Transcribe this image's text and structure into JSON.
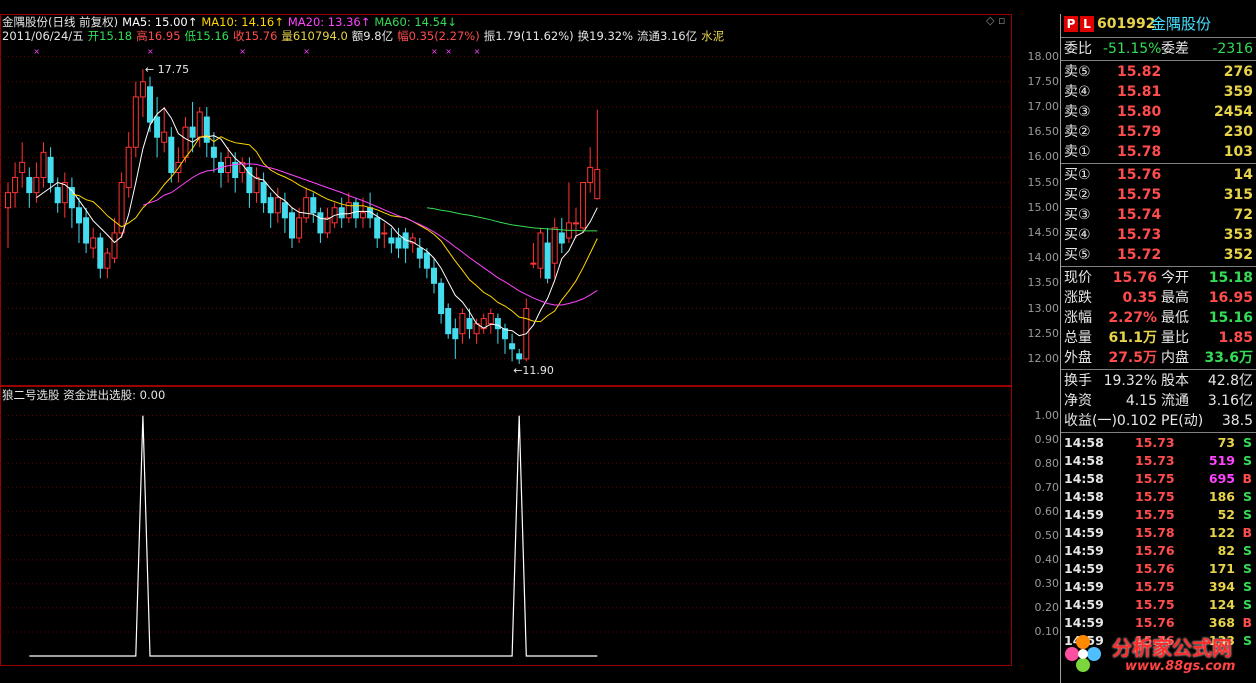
{
  "header": {
    "line1": [
      {
        "text": "金隅股份(日线 前复权)",
        "color": "#e6e6e6"
      },
      {
        "text": "MA5: 15.00↑",
        "color": "#ffffff"
      },
      {
        "text": "MA10: 14.16↑",
        "color": "#ffd700"
      },
      {
        "text": "MA20: 13.36↑",
        "color": "#ff44ff"
      },
      {
        "text": "MA60: 14.54↓",
        "color": "#33dd55"
      }
    ],
    "line2": [
      {
        "text": "2011/06/24/五",
        "color": "#e6e6e6"
      },
      {
        "text": "开15.18",
        "color": "#33dd55"
      },
      {
        "text": "高16.95",
        "color": "#ff4d4d"
      },
      {
        "text": "低15.16",
        "color": "#33dd55"
      },
      {
        "text": "收15.76",
        "color": "#ff4d4d"
      },
      {
        "text": "量610794.0",
        "color": "#e8d44a"
      },
      {
        "text": "额9.8亿",
        "color": "#e6e6e6"
      },
      {
        "text": "幅0.35(2.27%)",
        "color": "#ff4d4d"
      },
      {
        "text": "振1.79(11.62%)",
        "color": "#e6e6e6"
      },
      {
        "text": "换19.32%",
        "color": "#e6e6e6"
      },
      {
        "text": "流通3.16亿",
        "color": "#e6e6e6"
      },
      {
        "text": "水泥",
        "color": "#e8d44a"
      }
    ]
  },
  "indicator_header": "狼二号选股  资金进出选股: 0.00",
  "annotations": {
    "high": "17.75",
    "low": "←11.90"
  },
  "chart_data": [
    {
      "type": "candlestick",
      "yrange": [
        11.7,
        18.25
      ],
      "yticks": [
        "18.00",
        "17.50",
        "17.00",
        "16.50",
        "16.00",
        "15.50",
        "15.00",
        "14.50",
        "14.00",
        "13.50",
        "13.00",
        "12.50",
        "12.00"
      ],
      "candles": [
        [
          15.0,
          15.3,
          14.2,
          15.5
        ],
        [
          15.3,
          15.6,
          15.0,
          15.9
        ],
        [
          15.7,
          15.9,
          15.4,
          16.3
        ],
        [
          15.6,
          15.3,
          15.0,
          15.8
        ],
        [
          15.3,
          15.6,
          15.1,
          15.9
        ],
        [
          15.6,
          16.1,
          15.4,
          16.3
        ],
        [
          16.0,
          15.5,
          15.3,
          16.2
        ],
        [
          15.4,
          15.1,
          14.9,
          15.6
        ],
        [
          15.1,
          15.5,
          14.8,
          15.7
        ],
        [
          15.4,
          15.0,
          14.6,
          15.6
        ],
        [
          15.0,
          14.7,
          14.3,
          15.2
        ],
        [
          14.8,
          14.3,
          14.1,
          15.0
        ],
        [
          14.2,
          14.4,
          14.0,
          14.6
        ],
        [
          14.4,
          13.8,
          13.6,
          14.5
        ],
        [
          13.8,
          14.1,
          13.6,
          14.2
        ],
        [
          14.0,
          14.5,
          13.9,
          14.8
        ],
        [
          14.5,
          15.5,
          14.4,
          15.7
        ],
        [
          15.4,
          16.2,
          15.2,
          16.5
        ],
        [
          16.2,
          17.2,
          16.0,
          17.5
        ],
        [
          17.2,
          17.5,
          16.8,
          17.75
        ],
        [
          17.4,
          16.7,
          16.5,
          17.6
        ],
        [
          16.8,
          16.4,
          16.0,
          17.2
        ],
        [
          16.3,
          16.5,
          16.1,
          17.0
        ],
        [
          16.4,
          15.7,
          15.5,
          16.6
        ],
        [
          15.7,
          15.9,
          15.5,
          16.2
        ],
        [
          16.0,
          16.6,
          15.9,
          16.8
        ],
        [
          16.6,
          16.4,
          16.1,
          17.1
        ],
        [
          16.4,
          16.9,
          16.2,
          17.0
        ],
        [
          16.8,
          16.3,
          16.0,
          17.0
        ],
        [
          16.2,
          16.0,
          15.7,
          16.5
        ],
        [
          15.9,
          15.7,
          15.4,
          16.1
        ],
        [
          15.7,
          16.0,
          15.5,
          16.2
        ],
        [
          15.9,
          15.6,
          15.3,
          16.1
        ],
        [
          15.7,
          15.9,
          15.5,
          16.0
        ],
        [
          15.8,
          15.3,
          15.0,
          16.0
        ],
        [
          15.3,
          15.6,
          15.1,
          15.8
        ],
        [
          15.5,
          15.1,
          14.9,
          15.7
        ],
        [
          15.2,
          14.9,
          14.6,
          15.3
        ],
        [
          14.9,
          15.2,
          14.7,
          15.4
        ],
        [
          15.1,
          14.8,
          14.5,
          15.3
        ],
        [
          14.9,
          14.4,
          14.2,
          15.0
        ],
        [
          14.4,
          14.8,
          14.3,
          15.0
        ],
        [
          14.8,
          15.2,
          14.7,
          15.4
        ],
        [
          15.2,
          14.9,
          14.7,
          15.3
        ],
        [
          14.9,
          14.5,
          14.3,
          15.0
        ],
        [
          14.5,
          14.8,
          14.4,
          15.0
        ],
        [
          14.7,
          15.0,
          14.6,
          15.1
        ],
        [
          15.0,
          14.8,
          14.6,
          15.2
        ],
        [
          14.8,
          15.1,
          14.7,
          15.3
        ],
        [
          15.1,
          14.8,
          14.6,
          15.2
        ],
        [
          14.8,
          14.9,
          14.6,
          15.2
        ],
        [
          15.0,
          14.8,
          14.6,
          15.3
        ],
        [
          14.8,
          14.4,
          14.2,
          14.9
        ],
        [
          14.5,
          14.5,
          14.2,
          14.7
        ],
        [
          14.4,
          14.3,
          14.1,
          14.6
        ],
        [
          14.4,
          14.2,
          14.0,
          14.6
        ],
        [
          14.5,
          14.2,
          13.9,
          14.6
        ],
        [
          14.3,
          14.4,
          14.1,
          14.5
        ],
        [
          14.2,
          14.0,
          13.8,
          14.4
        ],
        [
          14.1,
          13.8,
          13.6,
          14.2
        ],
        [
          13.8,
          13.5,
          13.3,
          14.0
        ],
        [
          13.5,
          12.9,
          12.7,
          13.6
        ],
        [
          13.0,
          12.5,
          12.4,
          13.1
        ],
        [
          12.6,
          12.4,
          12.0,
          12.8
        ],
        [
          12.5,
          12.9,
          12.3,
          13.0
        ],
        [
          12.8,
          12.6,
          12.4,
          13.0
        ],
        [
          12.5,
          12.7,
          12.3,
          12.8
        ],
        [
          12.6,
          12.8,
          12.5,
          12.9
        ],
        [
          12.7,
          12.9,
          12.5,
          13.0
        ],
        [
          12.8,
          12.6,
          12.3,
          12.9
        ],
        [
          12.6,
          12.4,
          12.1,
          12.7
        ],
        [
          12.3,
          12.2,
          11.95,
          12.5
        ],
        [
          12.1,
          12.0,
          11.9,
          12.2
        ],
        [
          12.0,
          13.0,
          11.95,
          13.2
        ],
        [
          13.9,
          13.9,
          13.8,
          14.3
        ],
        [
          13.8,
          14.5,
          13.6,
          14.6
        ],
        [
          14.3,
          13.6,
          13.5,
          14.6
        ],
        [
          13.9,
          14.6,
          13.6,
          14.8
        ],
        [
          14.5,
          14.3,
          14.1,
          14.8
        ],
        [
          14.4,
          14.7,
          14.3,
          15.5
        ],
        [
          14.7,
          14.7,
          14.4,
          15.0
        ],
        [
          14.6,
          15.5,
          14.5,
          15.5
        ],
        [
          15.5,
          15.8,
          15.3,
          16.2
        ],
        [
          15.18,
          15.76,
          15.16,
          16.95
        ]
      ],
      "ma_series": [
        {
          "name": "MA5",
          "color": "#ffffff",
          "values": [
            null,
            null,
            null,
            null,
            15.2,
            15.3,
            15.4,
            15.5,
            15.46,
            15.34,
            15.15,
            14.95,
            14.74,
            14.6,
            14.46,
            14.31,
            14.43,
            14.87,
            15.5,
            16.17,
            16.64,
            16.86,
            16.98,
            16.78,
            16.47,
            16.37,
            16.3,
            16.4,
            16.41,
            16.43,
            16.36,
            16.16,
            15.98,
            15.86,
            15.68,
            15.58,
            15.55,
            15.38,
            15.23,
            15.14,
            15.0,
            14.91,
            14.89,
            14.87,
            14.79,
            14.77,
            14.85,
            14.88,
            14.88,
            14.92,
            14.93,
            14.92,
            14.83,
            14.74,
            14.64,
            14.47,
            14.36,
            14.32,
            14.23,
            14.14,
            14.0,
            13.8,
            13.53,
            13.26,
            13.13,
            12.93,
            12.7,
            12.61,
            12.69,
            12.67,
            12.58,
            12.56,
            12.46,
            12.5,
            12.67,
            12.96,
            13.2,
            13.56,
            13.99,
            14.15,
            14.44,
            14.51,
            14.72,
            15.0
          ]
        },
        {
          "name": "MA10",
          "color": "#ffd700",
          "values": [
            null,
            null,
            null,
            null,
            null,
            null,
            null,
            null,
            null,
            15.27,
            15.24,
            15.16,
            15.12,
            14.99,
            14.84,
            14.73,
            14.62,
            14.7,
            14.8,
            15.0,
            15.13,
            15.27,
            15.46,
            15.61,
            15.79,
            16.0,
            16.18,
            16.4,
            16.43,
            16.31,
            16.41,
            16.34,
            16.29,
            16.27,
            16.25,
            16.11,
            15.88,
            15.75,
            15.67,
            15.61,
            15.54,
            15.45,
            15.38,
            15.32,
            15.24,
            15.17,
            15.12,
            15.07,
            15.04,
            15.04,
            15.04,
            15.0,
            14.96,
            14.9,
            14.84,
            14.82,
            14.8,
            14.73,
            14.65,
            14.57,
            14.47,
            14.34,
            14.14,
            13.94,
            13.76,
            13.57,
            13.45,
            13.32,
            13.24,
            13.12,
            13.05,
            12.95,
            12.83,
            12.8,
            12.75,
            12.74,
            12.86,
            12.95,
            13.17,
            13.35,
            13.55,
            13.81,
            14.1,
            14.39
          ]
        },
        {
          "name": "MA20",
          "color": "#ff44ff",
          "values": [
            null,
            null,
            null,
            null,
            null,
            null,
            null,
            null,
            null,
            null,
            null,
            null,
            null,
            null,
            null,
            null,
            null,
            null,
            null,
            15.05,
            15.1,
            15.15,
            15.25,
            15.3,
            15.4,
            15.5,
            15.6,
            15.68,
            15.73,
            15.75,
            15.8,
            15.83,
            15.86,
            15.87,
            15.87,
            15.86,
            15.82,
            15.79,
            15.75,
            15.7,
            15.65,
            15.6,
            15.55,
            15.5,
            15.45,
            15.4,
            15.35,
            15.3,
            15.24,
            15.19,
            15.14,
            15.08,
            15.02,
            14.96,
            14.9,
            14.84,
            14.79,
            14.73,
            14.67,
            14.6,
            14.52,
            14.43,
            14.33,
            14.22,
            14.12,
            14.01,
            13.91,
            13.81,
            13.71,
            13.61,
            13.53,
            13.44,
            13.35,
            13.28,
            13.21,
            13.15,
            13.1,
            13.07,
            13.07,
            13.1,
            13.14,
            13.19,
            13.27,
            13.36
          ]
        },
        {
          "name": "MA60",
          "color": "#33dd55",
          "values": [
            null,
            null,
            null,
            null,
            null,
            null,
            null,
            null,
            null,
            null,
            null,
            null,
            null,
            null,
            null,
            null,
            null,
            null,
            null,
            null,
            null,
            null,
            null,
            null,
            null,
            null,
            null,
            null,
            null,
            null,
            null,
            null,
            null,
            null,
            null,
            null,
            null,
            null,
            null,
            null,
            null,
            null,
            null,
            null,
            null,
            null,
            null,
            null,
            null,
            null,
            null,
            null,
            null,
            null,
            null,
            null,
            null,
            null,
            null,
            15.0,
            14.98,
            14.95,
            14.93,
            14.9,
            14.87,
            14.85,
            14.82,
            14.79,
            14.76,
            14.72,
            14.69,
            14.66,
            14.64,
            14.62,
            14.6,
            14.59,
            14.58,
            14.57,
            14.56,
            14.55,
            14.55,
            14.54,
            14.54,
            14.54
          ]
        }
      ]
    },
    {
      "type": "line",
      "yrange": [
        0.0,
        1.04
      ],
      "yticks": [
        "1.00",
        "0.90",
        "0.80",
        "0.70",
        "0.60",
        "0.50",
        "0.40",
        "0.30",
        "0.20",
        "0.10"
      ],
      "peaks_at": [
        19,
        72
      ],
      "values_note": ""
    }
  ],
  "panel": {
    "badges": [
      "P",
      "L"
    ],
    "code": "601992",
    "name": "金隅股份",
    "weibi": {
      "label": "委比",
      "value": "-51.15%",
      "label2": "委差",
      "value2": "-2316"
    },
    "sells": [
      {
        "label": "卖⑤",
        "price": "15.82",
        "vol": "276"
      },
      {
        "label": "卖④",
        "price": "15.81",
        "vol": "359"
      },
      {
        "label": "卖③",
        "price": "15.80",
        "vol": "2454"
      },
      {
        "label": "卖②",
        "price": "15.79",
        "vol": "230"
      },
      {
        "label": "卖①",
        "price": "15.78",
        "vol": "103"
      }
    ],
    "buys": [
      {
        "label": "买①",
        "price": "15.76",
        "vol": "14"
      },
      {
        "label": "买②",
        "price": "15.75",
        "vol": "315"
      },
      {
        "label": "买③",
        "price": "15.74",
        "vol": "72"
      },
      {
        "label": "买④",
        "price": "15.73",
        "vol": "353"
      },
      {
        "label": "买⑤",
        "price": "15.72",
        "vol": "352"
      }
    ],
    "stats": [
      {
        "l1": "现价",
        "v1": "15.76",
        "c1": "red",
        "l2": "今开",
        "v2": "15.18",
        "c2": "green"
      },
      {
        "l1": "涨跌",
        "v1": "0.35",
        "c1": "red",
        "l2": "最高",
        "v2": "16.95",
        "c2": "red"
      },
      {
        "l1": "涨幅",
        "v1": "2.27%",
        "c1": "red",
        "l2": "最低",
        "v2": "15.16",
        "c2": "green"
      },
      {
        "l1": "总量",
        "v1": "61.1万",
        "c1": "yellow",
        "l2": "量比",
        "v2": "1.85",
        "c2": "red"
      },
      {
        "l1": "外盘",
        "v1": "27.5万",
        "c1": "red",
        "l2": "内盘",
        "v2": "33.6万",
        "c2": "green"
      }
    ],
    "stats2": [
      {
        "l1": "换手",
        "v1": "19.32%",
        "l2": "股本",
        "v2": "42.8亿"
      },
      {
        "l1": "净资",
        "v1": "4.15",
        "l2": "流通",
        "v2": "3.16亿"
      },
      {
        "l1": "收益(一)",
        "v1": "0.102",
        "l2": "PE(动)",
        "v2": "38.5"
      }
    ],
    "ticks": [
      {
        "time": "14:58",
        "price": "15.73",
        "vol": "73",
        "vcolor": "yellow",
        "side": "S"
      },
      {
        "time": "14:58",
        "price": "15.73",
        "vol": "519",
        "vcolor": "magenta",
        "side": "S"
      },
      {
        "time": "14:58",
        "price": "15.75",
        "vol": "695",
        "vcolor": "magenta",
        "side": "B"
      },
      {
        "time": "14:58",
        "price": "15.75",
        "vol": "186",
        "vcolor": "yellow",
        "side": "S"
      },
      {
        "time": "14:59",
        "price": "15.75",
        "vol": "52",
        "vcolor": "yellow",
        "side": "S"
      },
      {
        "time": "14:59",
        "price": "15.78",
        "vol": "122",
        "vcolor": "yellow",
        "side": "B"
      },
      {
        "time": "14:59",
        "price": "15.76",
        "vol": "82",
        "vcolor": "yellow",
        "side": "S"
      },
      {
        "time": "14:59",
        "price": "15.76",
        "vol": "171",
        "vcolor": "yellow",
        "side": "S"
      },
      {
        "time": "14:59",
        "price": "15.75",
        "vol": "394",
        "vcolor": "yellow",
        "side": "S"
      },
      {
        "time": "14:59",
        "price": "15.75",
        "vol": "124",
        "vcolor": "yellow",
        "side": "S"
      },
      {
        "time": "14:59",
        "price": "15.76",
        "vol": "368",
        "vcolor": "yellow",
        "side": "B"
      },
      {
        "time": "14:59",
        "price": "15.76",
        "vol": "133",
        "vcolor": "yellow",
        "side": "S"
      }
    ]
  },
  "watermark": {
    "text": "分析家公式网",
    "url": "www.88gs.com"
  },
  "colors": {
    "up": "#ff3333",
    "down": "#44ddee",
    "grid": "#6a0000",
    "border": "#9a0000"
  }
}
